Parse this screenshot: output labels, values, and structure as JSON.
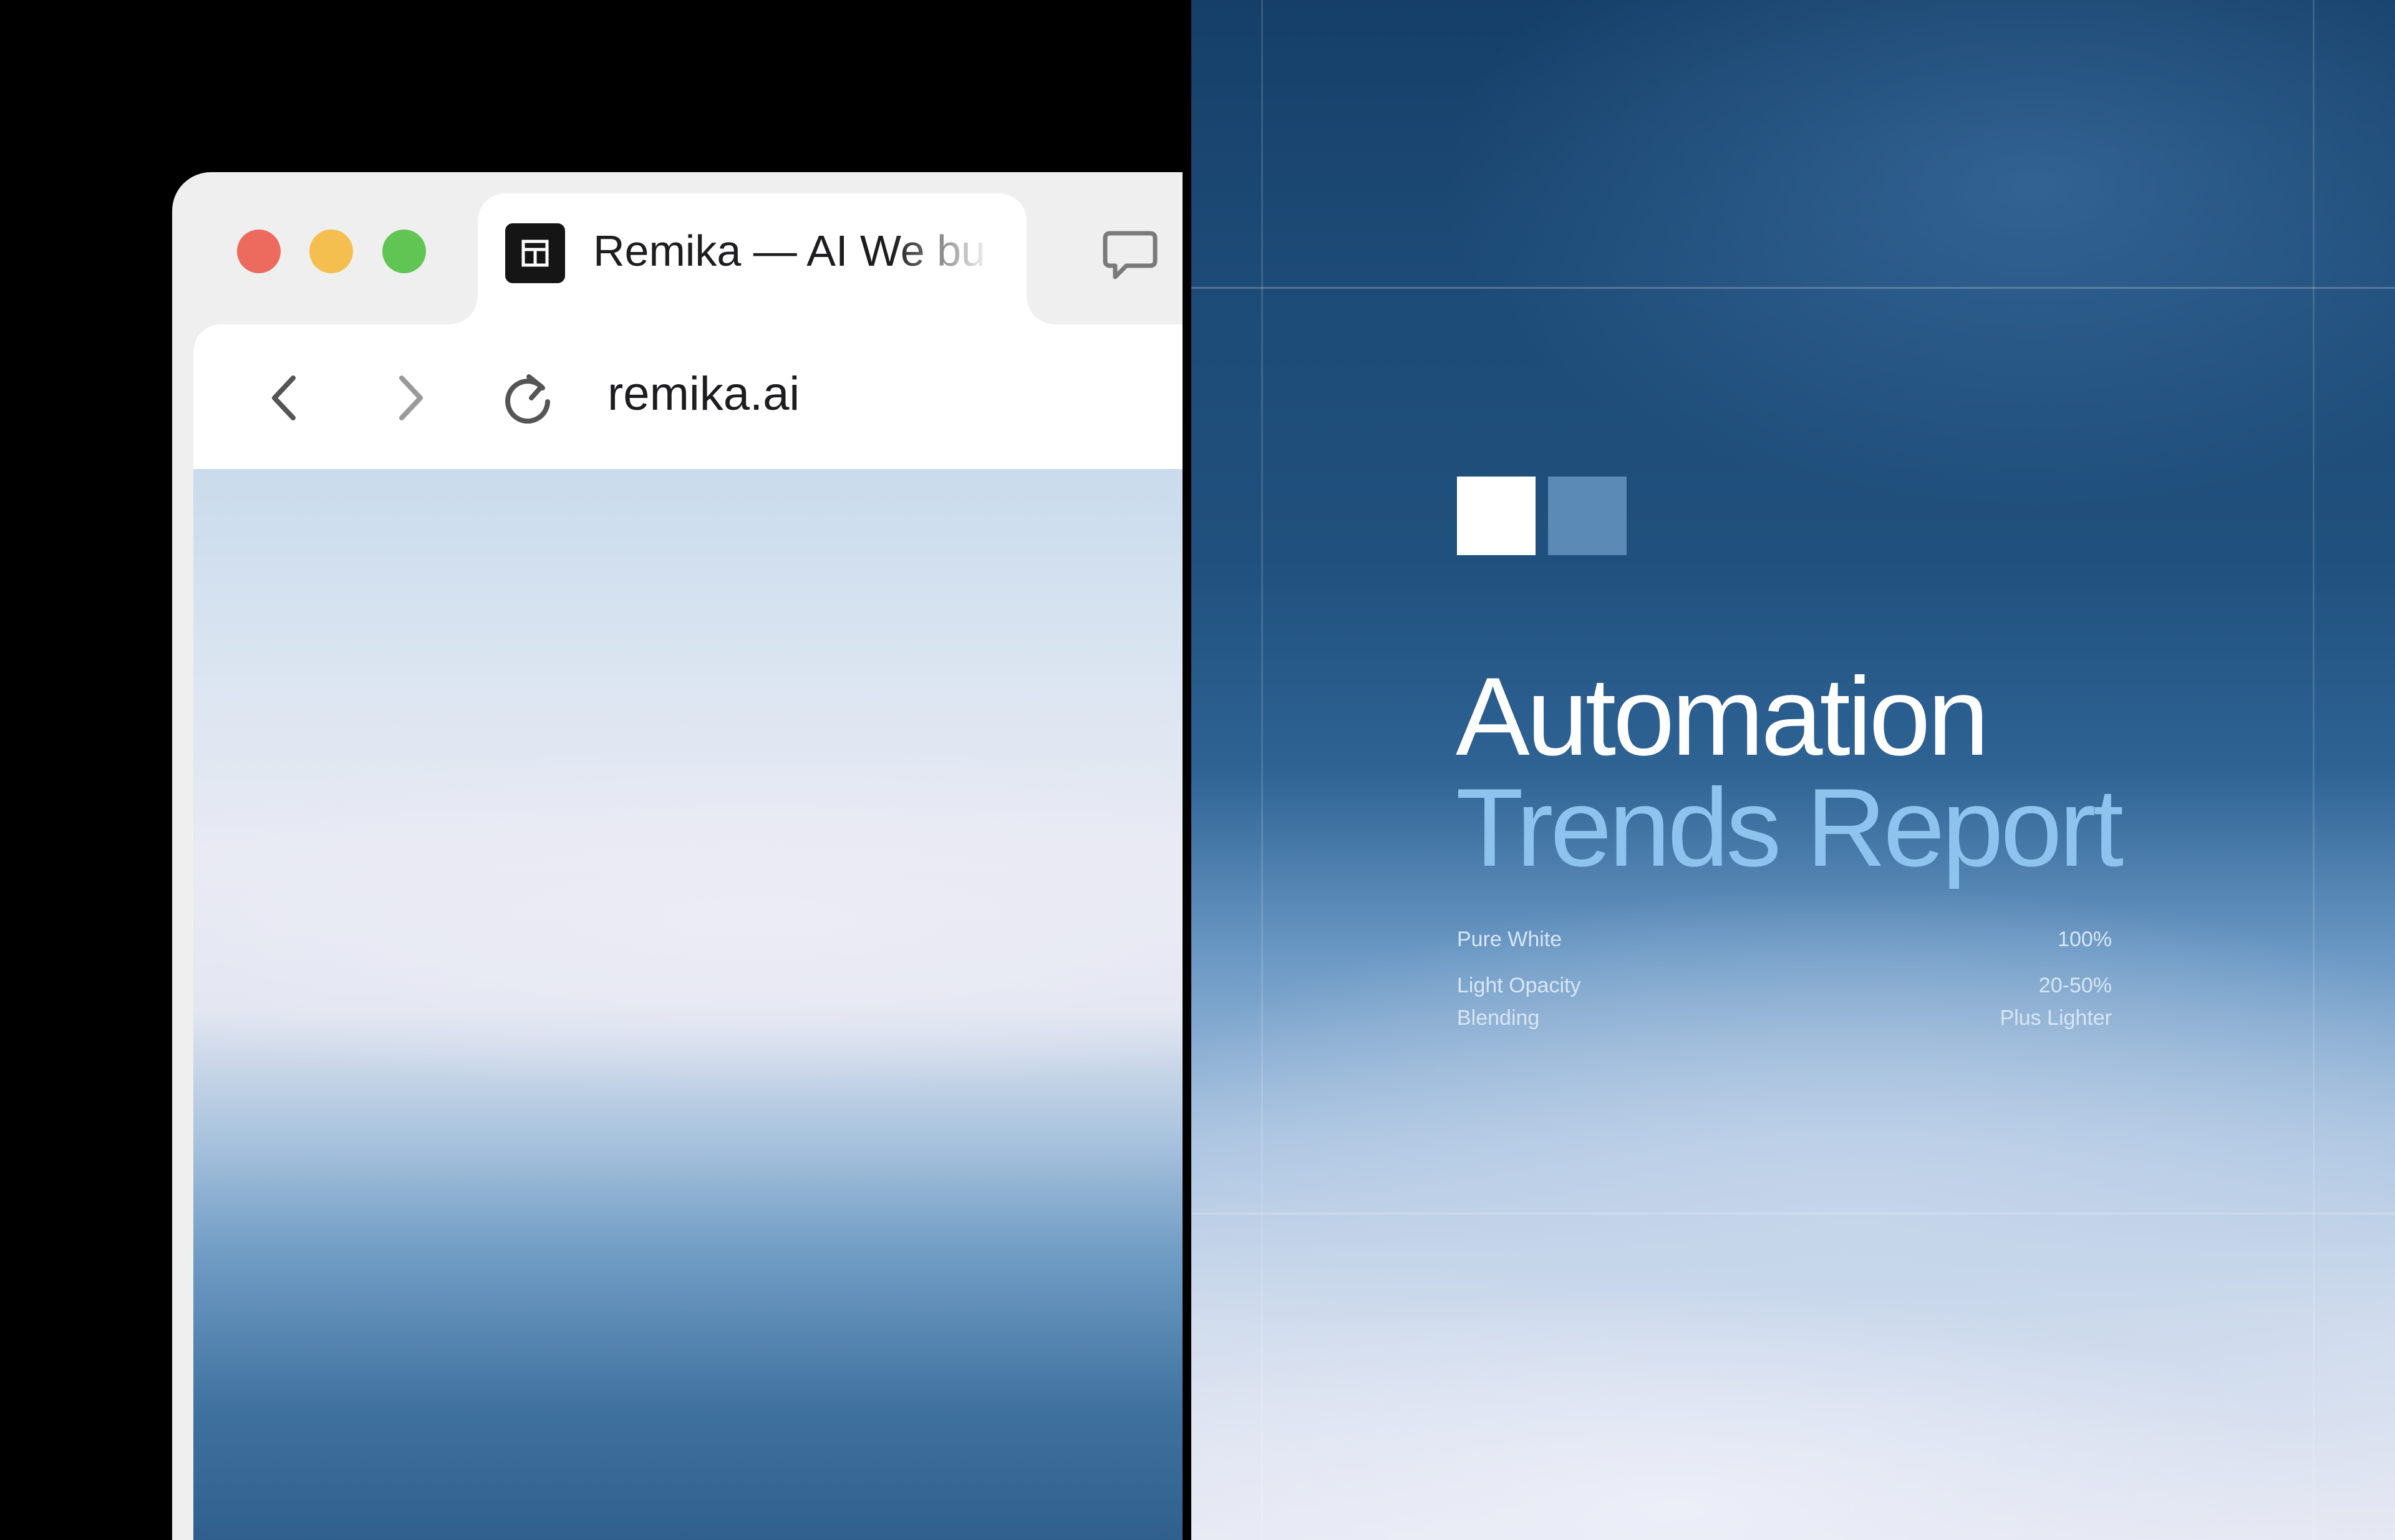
{
  "browser": {
    "tab_title": "Remika — AI We bu",
    "favicon": "layout-window-icon",
    "address_bar": {
      "url": "remika.ai"
    },
    "icons": {
      "back": "chevron-left-icon",
      "forward": "chevron-right-icon",
      "reload": "reload-icon",
      "chat": "chat-bubble-icon"
    },
    "traffic_lights": {
      "close": "#ec6a5e",
      "minimize": "#f4bf4f",
      "maximize": "#61c554"
    }
  },
  "report": {
    "title_line_1": "Automation",
    "title_line_2": "Trends Report",
    "title_colors": {
      "primary": "#ffffff",
      "accent": "#8ec3ee"
    },
    "logo_colors": {
      "solid": "#ffffff",
      "tint": "#5c8ab7"
    },
    "specs": [
      {
        "label": "Pure White",
        "value": "100%"
      },
      {
        "label": "Light Opacity",
        "value": "20-50%"
      },
      {
        "label": "Blending",
        "value": "Plus Lighter"
      }
    ]
  }
}
